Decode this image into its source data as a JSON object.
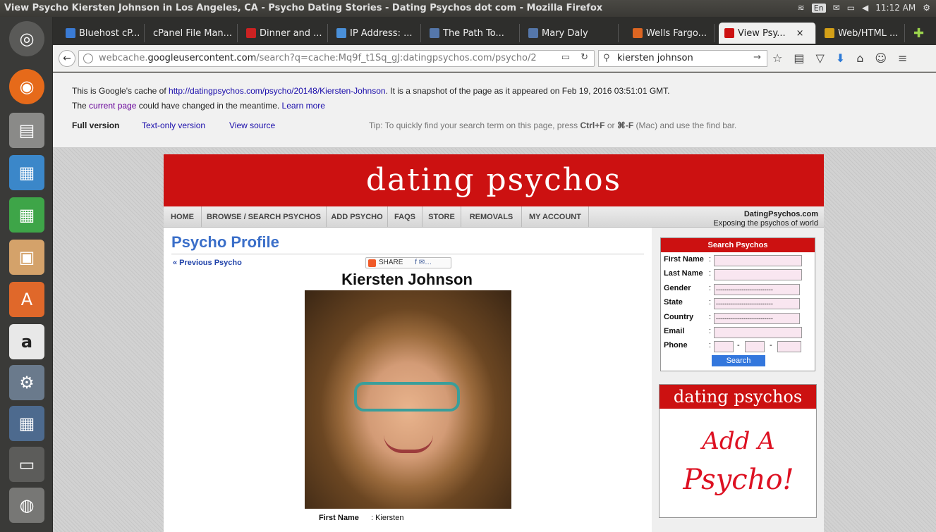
{
  "window": {
    "title": "View Psycho Kiersten Johnson in Los Angeles, CA - Psycho Dating Stories - Dating Psychos dot com - Mozilla Firefox",
    "lang": "En",
    "clock": "11:12 AM"
  },
  "tabs": [
    {
      "label": "Bluehost cP...",
      "color": "#3a7bd5"
    },
    {
      "label": "cPanel File Man...",
      "color": "#888888"
    },
    {
      "label": "Dinner and ...",
      "color": "#cc2222"
    },
    {
      "label": "IP Address: ...",
      "color": "#4a90d9"
    },
    {
      "label": "The Path To...",
      "color": "#5577aa"
    },
    {
      "label": "Mary Daly",
      "color": "#5577aa"
    },
    {
      "label": "Wells Fargo...",
      "color": "#dd6622"
    },
    {
      "label": "View Psy...",
      "color": "#cc1111"
    },
    {
      "label": "Web/HTML ...",
      "color": "#d4a017"
    }
  ],
  "navbar": {
    "url_prefix": "webcache.",
    "url_domain": "googleusercontent.com",
    "url_rest": "/search?q=cache:Mq9f_t1Sq_gJ:datingpsychos.com/psycho/2",
    "search_value": "kiersten johnson"
  },
  "cache_banner": {
    "line1_pre": "This is Google's cache of ",
    "line1_link": "http://datingpsychos.com/psycho/20148/Kiersten-Johnson",
    "line1_post": ". It is a snapshot of the page as it appeared on Feb 19, 2016 03:51:01 GMT.",
    "line2_pre": "The ",
    "line2_link": "current page",
    "line2_mid": " could have changed in the meantime. ",
    "line2_learn": "Learn more",
    "full_version": "Full version",
    "text_only": "Text-only version",
    "view_source": "View source",
    "tip_pre": "Tip: To quickly find your search term on this page, press ",
    "tip_key1": "Ctrl+F",
    "tip_mid": " or ",
    "tip_key2": "⌘-F",
    "tip_post": " (Mac) and use the find bar."
  },
  "site": {
    "banner": "dating psychos",
    "menu": [
      "HOME",
      "BROWSE / SEARCH PSYCHOS",
      "ADD PSYCHO",
      "FAQS",
      "STORE",
      "REMOVALS",
      "MY ACCOUNT"
    ],
    "tagline_1": "DatingPsychos.com",
    "tagline_2": "Exposing the psychos of world",
    "profile_title": "Psycho Profile",
    "prev": "« Previous Psycho",
    "share": "SHARE",
    "name": "Kiersten Johnson",
    "fields": [
      {
        "label": "First Name",
        "value": ": Kiersten"
      }
    ]
  },
  "search_box": {
    "header": "Search Psychos",
    "labels": [
      "First Name",
      "Last Name",
      "Gender",
      "State",
      "Country",
      "Email",
      "Phone"
    ],
    "select_placeholder": "---------------------------",
    "button": "Search"
  },
  "ad": {
    "banner": "dating psychos",
    "line1": "Add A",
    "line2": "Psycho!"
  }
}
